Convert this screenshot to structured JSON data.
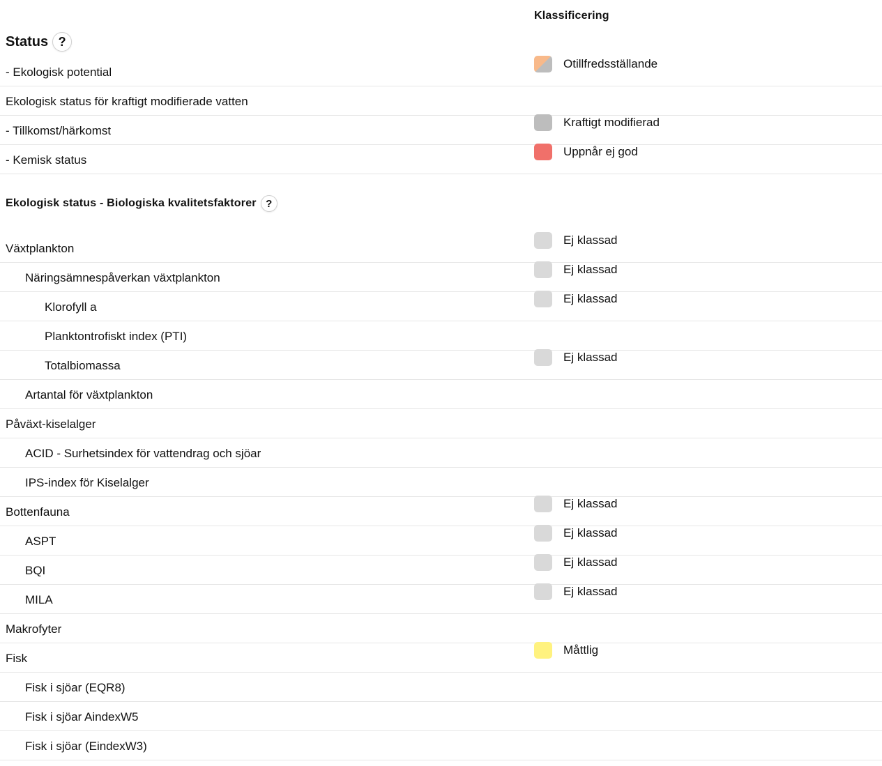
{
  "header": {
    "klassificering": "Klassificering"
  },
  "status_section": {
    "title": "Status",
    "help": "?",
    "rows": [
      {
        "label": "- Ekologisk potential",
        "class": "Otillfredsställande",
        "swatch": "split",
        "color_a": "#F8B98A",
        "color_b": "#BDBDBD"
      },
      {
        "label": "Ekologisk status för kraftigt modifierade vatten",
        "class": "",
        "swatch": "none"
      },
      {
        "label": "- Tillkomst/härkomst",
        "class": "Kraftigt modifierad",
        "swatch": "solid",
        "color": "#BDBDBD"
      },
      {
        "label": "- Kemisk status",
        "class": "Uppnår ej god",
        "swatch": "solid",
        "color": "#F0706A"
      }
    ]
  },
  "bio_section": {
    "title": "Ekologisk status - Biologiska kvalitetsfaktorer",
    "help": "?",
    "rows": [
      {
        "label": "Växtplankton",
        "level": 0,
        "class": "Ej klassad",
        "color": "#D9D9D9"
      },
      {
        "label": "Näringsämnespåverkan växtplankton",
        "level": 1,
        "class": "Ej klassad",
        "color": "#D9D9D9"
      },
      {
        "label": "Klorofyll a",
        "level": 2,
        "class": "Ej klassad",
        "color": "#D9D9D9"
      },
      {
        "label": "Planktontrofiskt index (PTI)",
        "level": 2,
        "class": "",
        "color": ""
      },
      {
        "label": "Totalbiomassa",
        "level": 2,
        "class": "Ej klassad",
        "color": "#D9D9D9"
      },
      {
        "label": "Artantal för växtplankton",
        "level": 1,
        "class": "",
        "color": ""
      },
      {
        "label": "Påväxt-kiselalger",
        "level": 0,
        "class": "",
        "color": ""
      },
      {
        "label": "ACID - Surhetsindex för vattendrag och sjöar",
        "level": 1,
        "class": "",
        "color": ""
      },
      {
        "label": "IPS-index för Kiselalger",
        "level": 1,
        "class": "",
        "color": ""
      },
      {
        "label": "Bottenfauna",
        "level": 0,
        "class": "Ej klassad",
        "color": "#D9D9D9"
      },
      {
        "label": "ASPT",
        "level": 1,
        "class": "Ej klassad",
        "color": "#D9D9D9"
      },
      {
        "label": "BQI",
        "level": 1,
        "class": "Ej klassad",
        "color": "#D9D9D9"
      },
      {
        "label": "MILA",
        "level": 1,
        "class": "Ej klassad",
        "color": "#D9D9D9"
      },
      {
        "label": "Makrofyter",
        "level": 0,
        "class": "",
        "color": ""
      },
      {
        "label": "Fisk",
        "level": 0,
        "class": "Måttlig",
        "color": "#FFF27F"
      },
      {
        "label": "Fisk i sjöar (EQR8)",
        "level": 1,
        "class": "",
        "color": ""
      },
      {
        "label": "Fisk i sjöar AindexW5",
        "level": 1,
        "class": "",
        "color": ""
      },
      {
        "label": "Fisk i sjöar (EindexW3)",
        "level": 1,
        "class": "",
        "color": ""
      }
    ]
  }
}
